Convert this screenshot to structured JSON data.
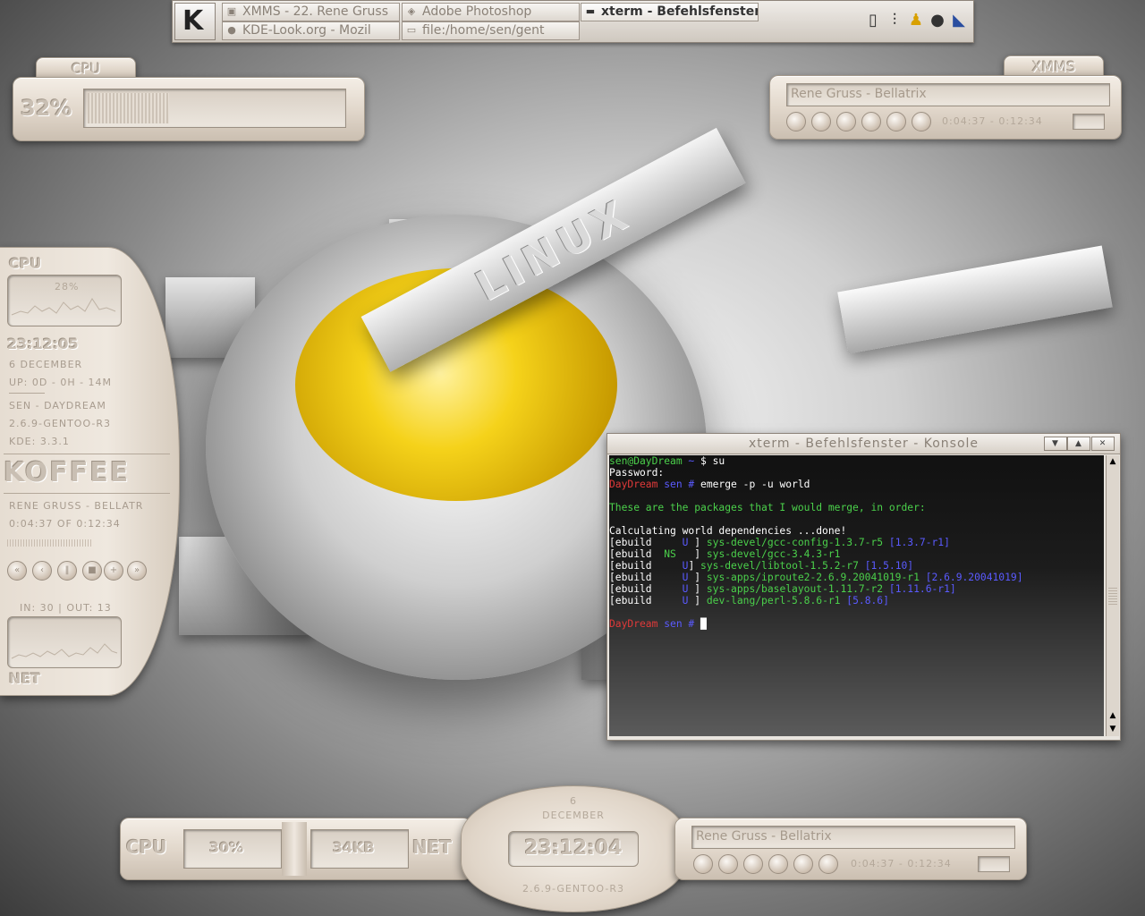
{
  "taskbar": {
    "tasks": [
      {
        "label": "XMMS - 22. Rene Gruss",
        "icon": "xmms-icon",
        "active": false
      },
      {
        "label": "Adobe Photoshop",
        "icon": "photoshop-icon",
        "active": false
      },
      {
        "label": "xterm - Befehlsfenster",
        "icon": "terminal-icon",
        "active": true
      },
      {
        "label": "KDE-Look.org - Mozil",
        "icon": "mozilla-icon",
        "active": false
      },
      {
        "label": "file:/home/sen/gent",
        "icon": "folder-icon",
        "active": false
      }
    ]
  },
  "cpu_widget": {
    "tab": "CPU",
    "value": "32%",
    "load_fraction": 0.32
  },
  "xmms_widget": {
    "tab": "XMMS",
    "track": "Rene Gruss  - Bellatrix",
    "time": "0:04:37 - 0:12:34"
  },
  "sidebar": {
    "cpu_title": "CPU",
    "cpu_value": "28%",
    "time": "23:12:05",
    "date": "6 DECEMBER",
    "uptime": "UP:  0D - 0H - 14M",
    "user_host": "SEN - DAYDREAM",
    "kernel": "2.6.9-GENTOO-R3",
    "kde": "KDE: 3.3.1",
    "player_logo": "KOFFEE",
    "track": "RENE GRUSS  - BELLATR",
    "track_time": "0:04:37 OF 0:12:34",
    "net_io": "IN: 30 | OUT: 13",
    "net_title": "NET"
  },
  "xterm": {
    "title": "xterm - Befehlsfenster - Konsole",
    "lines": [
      [
        {
          "c": "g",
          "t": "sen@DayDream"
        },
        {
          "c": "b",
          "t": " ~ "
        },
        {
          "c": "w",
          "t": "$ su"
        }
      ],
      [
        {
          "c": "w",
          "t": "Password:"
        }
      ],
      [
        {
          "c": "r",
          "t": "DayDream"
        },
        {
          "c": "b",
          "t": " sen # "
        },
        {
          "c": "w",
          "t": "emerge -p -u world"
        }
      ],
      [
        {
          "c": "w",
          "t": ""
        }
      ],
      [
        {
          "c": "g",
          "t": "These are the packages that I would merge, in order:"
        }
      ],
      [
        {
          "c": "w",
          "t": ""
        }
      ],
      [
        {
          "c": "w",
          "t": "Calculating world dependencies ...done!"
        }
      ],
      [
        {
          "c": "w",
          "t": "[ebuild     "
        },
        {
          "c": "b",
          "t": "U"
        },
        {
          "c": "w",
          "t": " ] "
        },
        {
          "c": "g",
          "t": "sys-devel/gcc-config-1.3.7-r5"
        },
        {
          "c": "b",
          "t": " [1.3.7-r1]"
        }
      ],
      [
        {
          "c": "w",
          "t": "[ebuild  "
        },
        {
          "c": "g",
          "t": "NS"
        },
        {
          "c": "w",
          "t": "   ] "
        },
        {
          "c": "g",
          "t": "sys-devel/gcc-3.4.3-r1"
        }
      ],
      [
        {
          "c": "w",
          "t": "[ebuild     "
        },
        {
          "c": "b",
          "t": "U"
        },
        {
          "c": "w",
          "t": "] "
        },
        {
          "c": "g",
          "t": "sys-devel/libtool-1.5.2-r7"
        },
        {
          "c": "b",
          "t": " [1.5.10]"
        }
      ],
      [
        {
          "c": "w",
          "t": "[ebuild     "
        },
        {
          "c": "b",
          "t": "U"
        },
        {
          "c": "w",
          "t": " ] "
        },
        {
          "c": "g",
          "t": "sys-apps/iproute2-2.6.9.20041019-r1"
        },
        {
          "c": "b",
          "t": " [2.6.9.20041019]"
        }
      ],
      [
        {
          "c": "w",
          "t": "[ebuild     "
        },
        {
          "c": "b",
          "t": "U"
        },
        {
          "c": "w",
          "t": " ] "
        },
        {
          "c": "g",
          "t": "sys-apps/baselayout-1.11.7-r2"
        },
        {
          "c": "b",
          "t": " [1.11.6-r1]"
        }
      ],
      [
        {
          "c": "w",
          "t": "[ebuild     "
        },
        {
          "c": "b",
          "t": "U"
        },
        {
          "c": "w",
          "t": " ] "
        },
        {
          "c": "g",
          "t": "dev-lang/perl-5.8.6-r1"
        },
        {
          "c": "b",
          "t": " [5.8.6]"
        }
      ],
      [
        {
          "c": "w",
          "t": ""
        }
      ],
      [
        {
          "c": "r",
          "t": "DayDream"
        },
        {
          "c": "b",
          "t": " sen # "
        },
        {
          "c": "w",
          "t": "█"
        }
      ]
    ]
  },
  "bottom": {
    "cpu_label": "CPU",
    "cpu_value": "30%",
    "net_value": "34KB",
    "net_label": "NET",
    "day": "6",
    "month": "DECEMBER",
    "time": "23:12:04",
    "kernel": "2.6.9-GENTOO-R3",
    "track": "Rene Gruss  - Bellatrix",
    "track_time": "0:04:37 - 0:12:34"
  },
  "wallpaper": {
    "text": "LINUX"
  }
}
